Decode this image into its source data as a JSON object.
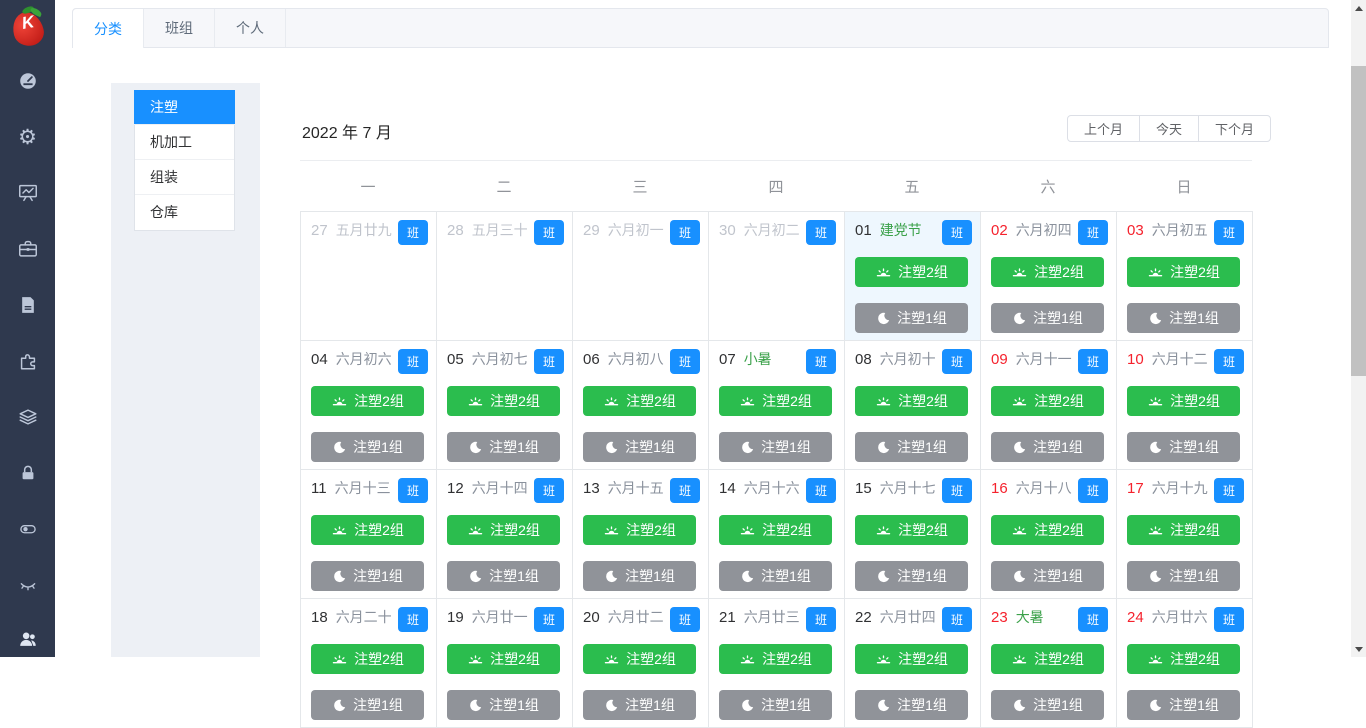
{
  "colors": {
    "sidebar_bg": "#2f394e",
    "accent_blue": "#1890ff",
    "shift_day_green": "#2bbd4e",
    "shift_night_gray": "#909399",
    "weekend_red": "#f5222d",
    "holiday_green": "#3ba14a",
    "muted_gray": "#c0c4cc"
  },
  "sidebar": {
    "logo_letter": "K",
    "icons": [
      {
        "name": "dashboard"
      },
      {
        "name": "settings"
      },
      {
        "name": "presentation"
      },
      {
        "name": "briefcase"
      },
      {
        "name": "document"
      },
      {
        "name": "puzzle"
      },
      {
        "name": "layers"
      },
      {
        "name": "lock"
      },
      {
        "name": "toggle"
      },
      {
        "name": "eye-closed"
      },
      {
        "name": "users"
      }
    ]
  },
  "tabs": [
    {
      "label": "分类",
      "active": true
    },
    {
      "label": "班组",
      "active": false
    },
    {
      "label": "个人",
      "active": false
    }
  ],
  "categories": [
    {
      "label": "注塑",
      "active": true
    },
    {
      "label": "机加工",
      "active": false
    },
    {
      "label": "组装",
      "active": false
    },
    {
      "label": "仓库",
      "active": false
    }
  ],
  "calendar": {
    "title": "2022 年 7 月",
    "nav": {
      "prev": "上个月",
      "today": "今天",
      "next": "下个月"
    },
    "weekdays": [
      "一",
      "二",
      "三",
      "四",
      "五",
      "六",
      "日"
    ],
    "badge_label": "班",
    "day_shift_label": "注塑2组",
    "night_shift_label": "注塑1组",
    "cells": [
      {
        "date": "27",
        "label": "五月廿九",
        "date_style": "muted",
        "label_style": "muted",
        "shifts": false,
        "highlight": false
      },
      {
        "date": "28",
        "label": "五月三十",
        "date_style": "muted",
        "label_style": "muted",
        "shifts": false,
        "highlight": false
      },
      {
        "date": "29",
        "label": "六月初一",
        "date_style": "muted",
        "label_style": "muted",
        "shifts": false,
        "highlight": false
      },
      {
        "date": "30",
        "label": "六月初二",
        "date_style": "muted",
        "label_style": "muted",
        "shifts": false,
        "highlight": false
      },
      {
        "date": "01",
        "label": "建党节",
        "date_style": "normal",
        "label_style": "green",
        "shifts": true,
        "highlight": true
      },
      {
        "date": "02",
        "label": "六月初四",
        "date_style": "red",
        "label_style": "normal",
        "shifts": true,
        "highlight": false
      },
      {
        "date": "03",
        "label": "六月初五",
        "date_style": "red",
        "label_style": "normal",
        "shifts": true,
        "highlight": false
      },
      {
        "date": "04",
        "label": "六月初六",
        "date_style": "normal",
        "label_style": "normal",
        "shifts": true,
        "highlight": false
      },
      {
        "date": "05",
        "label": "六月初七",
        "date_style": "normal",
        "label_style": "normal",
        "shifts": true,
        "highlight": false
      },
      {
        "date": "06",
        "label": "六月初八",
        "date_style": "normal",
        "label_style": "normal",
        "shifts": true,
        "highlight": false
      },
      {
        "date": "07",
        "label": "小暑",
        "date_style": "normal",
        "label_style": "green",
        "shifts": true,
        "highlight": false
      },
      {
        "date": "08",
        "label": "六月初十",
        "date_style": "normal",
        "label_style": "normal",
        "shifts": true,
        "highlight": false
      },
      {
        "date": "09",
        "label": "六月十一",
        "date_style": "red",
        "label_style": "normal",
        "shifts": true,
        "highlight": false
      },
      {
        "date": "10",
        "label": "六月十二",
        "date_style": "red",
        "label_style": "normal",
        "shifts": true,
        "highlight": false
      },
      {
        "date": "11",
        "label": "六月十三",
        "date_style": "normal",
        "label_style": "normal",
        "shifts": true,
        "highlight": false
      },
      {
        "date": "12",
        "label": "六月十四",
        "date_style": "normal",
        "label_style": "normal",
        "shifts": true,
        "highlight": false
      },
      {
        "date": "13",
        "label": "六月十五",
        "date_style": "normal",
        "label_style": "normal",
        "shifts": true,
        "highlight": false
      },
      {
        "date": "14",
        "label": "六月十六",
        "date_style": "normal",
        "label_style": "normal",
        "shifts": true,
        "highlight": false
      },
      {
        "date": "15",
        "label": "六月十七",
        "date_style": "normal",
        "label_style": "normal",
        "shifts": true,
        "highlight": false
      },
      {
        "date": "16",
        "label": "六月十八",
        "date_style": "red",
        "label_style": "normal",
        "shifts": true,
        "highlight": false
      },
      {
        "date": "17",
        "label": "六月十九",
        "date_style": "red",
        "label_style": "normal",
        "shifts": true,
        "highlight": false
      },
      {
        "date": "18",
        "label": "六月二十",
        "date_style": "normal",
        "label_style": "normal",
        "shifts": true,
        "highlight": false
      },
      {
        "date": "19",
        "label": "六月廿一",
        "date_style": "normal",
        "label_style": "normal",
        "shifts": true,
        "highlight": false
      },
      {
        "date": "20",
        "label": "六月廿二",
        "date_style": "normal",
        "label_style": "normal",
        "shifts": true,
        "highlight": false
      },
      {
        "date": "21",
        "label": "六月廿三",
        "date_style": "normal",
        "label_style": "normal",
        "shifts": true,
        "highlight": false
      },
      {
        "date": "22",
        "label": "六月廿四",
        "date_style": "normal",
        "label_style": "normal",
        "shifts": true,
        "highlight": false
      },
      {
        "date": "23",
        "label": "大暑",
        "date_style": "red",
        "label_style": "green",
        "shifts": true,
        "highlight": false
      },
      {
        "date": "24",
        "label": "六月廿六",
        "date_style": "red",
        "label_style": "normal",
        "shifts": true,
        "highlight": false
      }
    ]
  }
}
